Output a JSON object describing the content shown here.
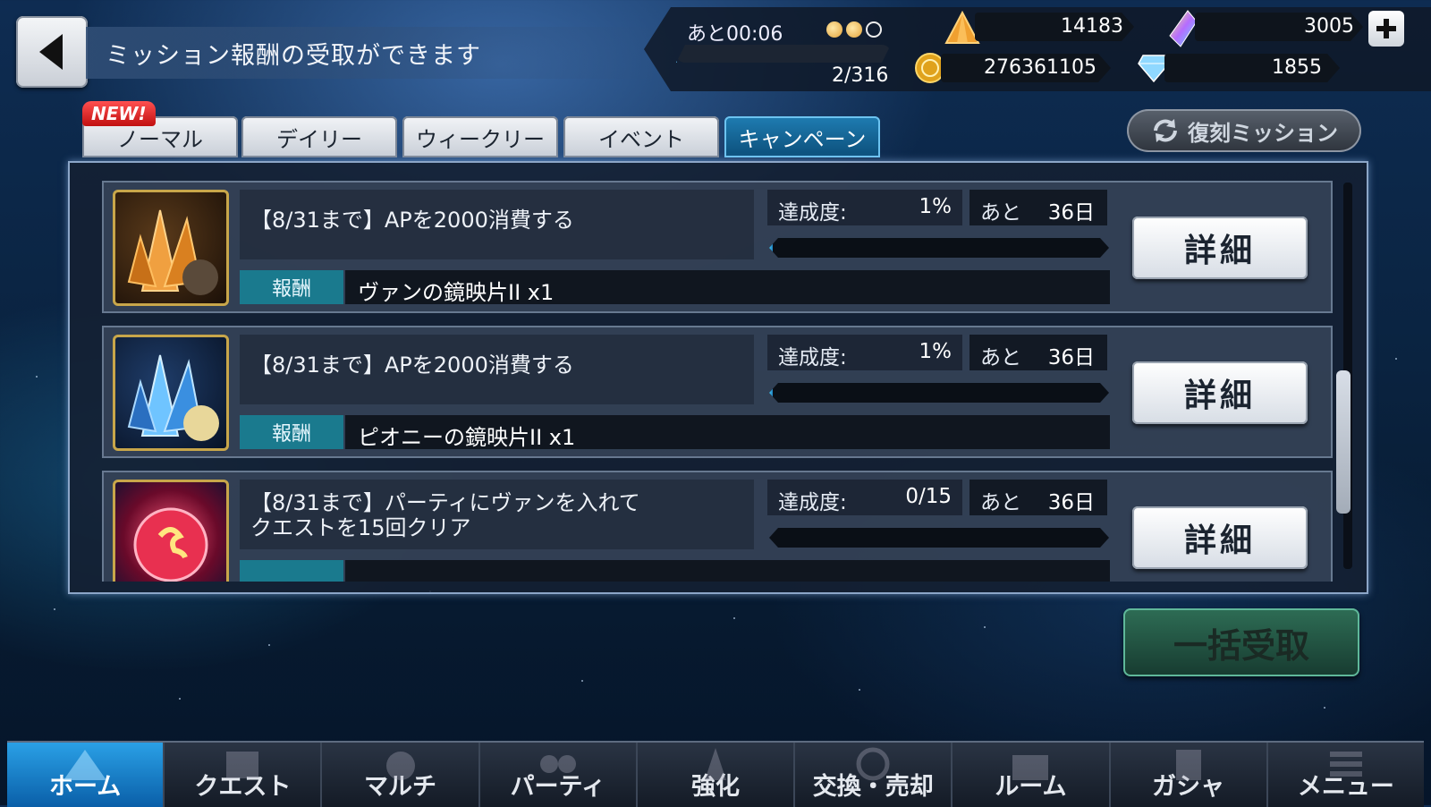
{
  "header": {
    "title": "ミッション報酬の受取ができます",
    "timer": "あと00:06",
    "stamina": "2/316",
    "stamina_ratio": 0.006,
    "energy_orbs_filled": 2,
    "energy_orbs_total": 3
  },
  "resources": {
    "crystal_orange": "14183",
    "crystal_rainbow": "3005",
    "gil": "276361105",
    "diamond": "1855"
  },
  "tabs": [
    {
      "label": "ノーマル",
      "active": false,
      "badge": "NEW!"
    },
    {
      "label": "デイリー",
      "active": false
    },
    {
      "label": "ウィークリー",
      "active": false
    },
    {
      "label": "イベント",
      "active": false
    },
    {
      "label": "キャンペーン",
      "active": true
    }
  ],
  "revival_button": "復刻ミッション",
  "missions": [
    {
      "title": "【8/31まで】APを2000消費する",
      "progress_label": "達成度:",
      "progress_value": "1%",
      "progress_ratio": 0.01,
      "remain_label": "あと",
      "remain_value": "36日",
      "reward_label": "報酬",
      "reward": "ヴァンの鏡映片II x1",
      "detail_button": "詳細",
      "icon": "amber-crystal-icon"
    },
    {
      "title": "【8/31まで】APを2000消費する",
      "progress_label": "達成度:",
      "progress_value": "1%",
      "progress_ratio": 0.01,
      "remain_label": "あと",
      "remain_value": "36日",
      "reward_label": "報酬",
      "reward": "ピオニーの鏡映片II x1",
      "detail_button": "詳細",
      "icon": "blue-crystal-icon"
    },
    {
      "title": "【8/31まで】パーティにヴァンを入れて\nクエストを15回クリア",
      "progress_label": "達成度:",
      "progress_value": "0/15",
      "progress_ratio": 0,
      "remain_label": "あと",
      "remain_value": "36日",
      "reward_label": "",
      "reward": "",
      "detail_button": "詳細",
      "icon": "red-orb-icon"
    }
  ],
  "bulk_receive_button": "一括受取",
  "bottom_nav": [
    {
      "label": "ホーム",
      "active": true
    },
    {
      "label": "クエスト",
      "active": false
    },
    {
      "label": "マルチ",
      "active": false
    },
    {
      "label": "パーティ",
      "active": false
    },
    {
      "label": "強化",
      "active": false
    },
    {
      "label": "交換・売却",
      "active": false
    },
    {
      "label": "ルーム",
      "active": false
    },
    {
      "label": "ガシャ",
      "active": false
    },
    {
      "label": "メニュー",
      "active": false
    }
  ]
}
